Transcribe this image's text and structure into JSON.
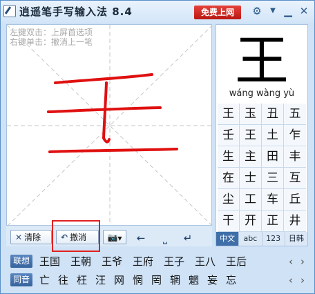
{
  "title": {
    "app_name": "逍遥笔手写输入法 8.4",
    "promo_button": "免费上网",
    "icons": [
      "gear-icon",
      "chevron-down-icon",
      "minimize-icon",
      "close-icon"
    ]
  },
  "pad": {
    "hint_left_double": "左键双击：上屏首选项",
    "hint_right_single": "右键单击：撤消上一笔"
  },
  "toolbar": {
    "clear_label": "清除",
    "undo_label": "撤消"
  },
  "candidates": {
    "top_char": "王",
    "pinyin": "wáng wàng yù",
    "grid": [
      "王",
      "玉",
      "丑",
      "五",
      "壬",
      "王",
      "土",
      "乍",
      "生",
      "主",
      "田",
      "丰",
      "在",
      "士",
      "三",
      "互",
      "尘",
      "工",
      "车",
      "丘",
      "干",
      "开",
      "正",
      "井"
    ],
    "modes": [
      {
        "label": "中文",
        "active": true
      },
      {
        "label": "abc",
        "active": false
      },
      {
        "label": "123",
        "active": false
      },
      {
        "label": "日韩",
        "active": false
      }
    ]
  },
  "suggestions": {
    "lianxiang_tag": "联想",
    "lianxiang_words": [
      "王国",
      "王朝",
      "王爷",
      "王府",
      "王子",
      "王八",
      "王后"
    ],
    "tongyin_tag": "同音",
    "tongyin_words": [
      "亡",
      "往",
      "枉",
      "汪",
      "网",
      "惘",
      "罔",
      "辋",
      "魍",
      "妄",
      "忘"
    ]
  },
  "colors": {
    "ink": "#e01010",
    "accent": "#35639c",
    "promo": "#d42a22"
  }
}
